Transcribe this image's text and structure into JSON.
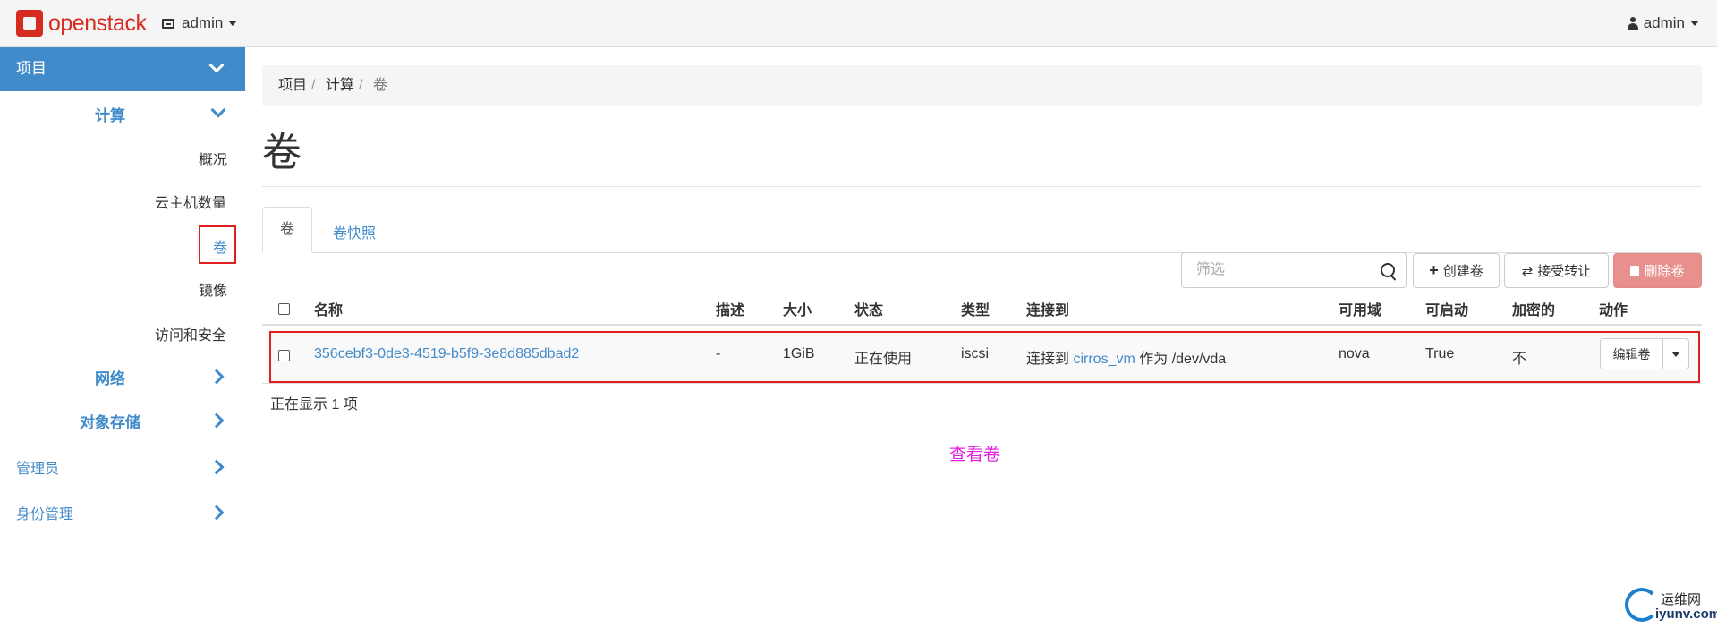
{
  "navbar": {
    "logo_text": "openstack",
    "project_switcher": "admin",
    "user_menu": "admin"
  },
  "sidebar": {
    "project": "项目",
    "compute": "计算",
    "compute_items": [
      "概况",
      "云主机数量",
      "卷",
      "镜像",
      "访问和安全"
    ],
    "network": "网络",
    "object_storage": "对象存储",
    "admin": "管理员",
    "identity": "身份管理"
  },
  "breadcrumb": [
    "项目",
    "计算",
    "卷"
  ],
  "page": {
    "title": "卷"
  },
  "tabs": [
    "卷",
    "卷快照"
  ],
  "toolbar": {
    "filter_placeholder": "筛选",
    "create": "创建卷",
    "accept_transfer": "接受转让",
    "delete": "删除卷"
  },
  "table": {
    "headers": [
      "名称",
      "描述",
      "大小",
      "状态",
      "类型",
      "连接到",
      "可用域",
      "可启动",
      "加密的",
      "动作"
    ],
    "rows": [
      {
        "name": "356cebf3-0de3-4519-b5f9-3e8d885dbad2",
        "description": "-",
        "size": "1GiB",
        "status": "正在使用",
        "type": "iscsi",
        "attached_prefix": "连接到",
        "attached_instance": "cirros_vm",
        "attached_suffix": "作为 /dev/vda",
        "availability_zone": "nova",
        "bootable": "True",
        "encrypted": "不",
        "action": "编辑卷"
      }
    ],
    "footer": "正在显示 1 项"
  },
  "annotation": "查看卷",
  "watermark": {
    "line1": "运维网",
    "line2": "iyunv.com"
  },
  "colors": {
    "primary": "#428bca",
    "brand": "#d62b1f",
    "highlight": "#e02020",
    "annotation": "#e020e0",
    "danger": "#e8908e"
  }
}
